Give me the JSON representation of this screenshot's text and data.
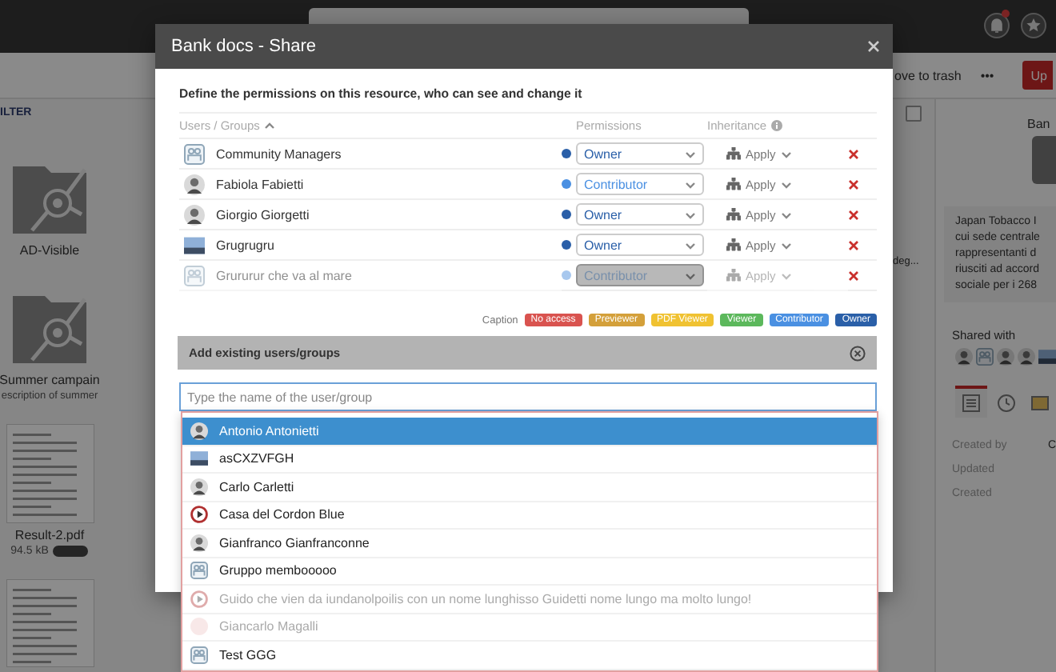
{
  "app": {
    "toolbar": {
      "trash": "ove to trash",
      "more": "•••",
      "upload": "Up"
    },
    "filter": "ILTER",
    "files": [
      {
        "kind": "folder",
        "name": "AD-Visible"
      },
      {
        "kind": "folder",
        "name": "Summer campain",
        "description": "escription of summer"
      },
      {
        "kind": "document",
        "name": "Result-2.pdf",
        "size": "94.5 kB"
      },
      {
        "kind": "document"
      }
    ],
    "select_all": {
      "checked": false
    },
    "side_text": "deg...",
    "details": {
      "title": "Ban",
      "description": [
        "Japan Tobacco I",
        "cui sede centrale",
        "rappresentanti d",
        "riusciti ad accord",
        "sociale per i 268"
      ],
      "shared_with": "Shared with",
      "shared_avatars": [
        {
          "kind": "person"
        },
        {
          "kind": "group"
        },
        {
          "kind": "person"
        },
        {
          "kind": "person"
        },
        {
          "kind": "image"
        }
      ],
      "tabs": [
        {
          "kind": "list",
          "selected": true
        },
        {
          "kind": "history",
          "selected": false
        },
        {
          "kind": "image",
          "selected": false
        }
      ],
      "properties": [
        {
          "label": "Created by",
          "value": "C"
        },
        {
          "label": "Updated"
        },
        {
          "label": "Created"
        }
      ]
    }
  },
  "dialog": {
    "title": "Bank docs - Share",
    "intro": "Define the permissions on this resource, who can see and change it",
    "columns": [
      "Users / Groups",
      "Permissions",
      "Inheritance"
    ],
    "members": [
      {
        "kind": "group",
        "name": "Community Managers",
        "permission": "Owner",
        "color": "#2a5fa8",
        "inheritance": "Apply",
        "disabled": false
      },
      {
        "kind": "person",
        "name": "Fabiola Fabietti",
        "permission": "Contributor",
        "color": "#4a90e2",
        "inheritance": "Apply",
        "disabled": false
      },
      {
        "kind": "person",
        "name": "Giorgio Giorgetti",
        "permission": "Owner",
        "color": "#2a5fa8",
        "inheritance": "Apply",
        "disabled": false
      },
      {
        "kind": "image",
        "name": "Grugrugru",
        "permission": "Owner",
        "color": "#2a5fa8",
        "inheritance": "Apply",
        "disabled": false
      },
      {
        "kind": "group",
        "name": "Grururur che va al mare",
        "permission": "Contributor",
        "color": "#a8c8ee",
        "inheritance": "Apply",
        "disabled": true
      }
    ],
    "caption_label": "Caption",
    "caption_tags": [
      {
        "label": "No access",
        "color": "#d9534f"
      },
      {
        "label": "Previewer",
        "color": "#d4a03a"
      },
      {
        "label": "PDF Viewer",
        "color": "#f0c231"
      },
      {
        "label": "Viewer",
        "color": "#5cb85c"
      },
      {
        "label": "Contributor",
        "color": "#4a90e2"
      },
      {
        "label": "Owner",
        "color": "#2a5fa8"
      }
    ],
    "add_title": "Add existing users/groups",
    "placeholder": "Type the name of the user/group",
    "suggestions": [
      {
        "kind": "person",
        "name": "Antonio Antonietti",
        "selected": true,
        "disabled": false
      },
      {
        "kind": "image",
        "name": "asCXZVFGH",
        "selected": false,
        "disabled": false
      },
      {
        "kind": "person",
        "name": "Carlo Carletti",
        "selected": false,
        "disabled": false
      },
      {
        "kind": "play",
        "name": "Casa del Cordon Blue",
        "selected": false,
        "disabled": false
      },
      {
        "kind": "person",
        "name": "Gianfranco Gianfranconne",
        "selected": false,
        "disabled": false
      },
      {
        "kind": "group",
        "name": "Gruppo membooooo",
        "selected": false,
        "disabled": false
      },
      {
        "kind": "play",
        "name": "Guido che vien da iundanolpoilis con un nome lunghisso Guidetti nome lungo ma molto lungo!",
        "selected": false,
        "disabled": true
      },
      {
        "kind": "blank",
        "name": "Giancarlo Magalli",
        "selected": false,
        "disabled": true
      },
      {
        "kind": "group",
        "name": "Test GGG",
        "selected": false,
        "disabled": false
      }
    ]
  }
}
